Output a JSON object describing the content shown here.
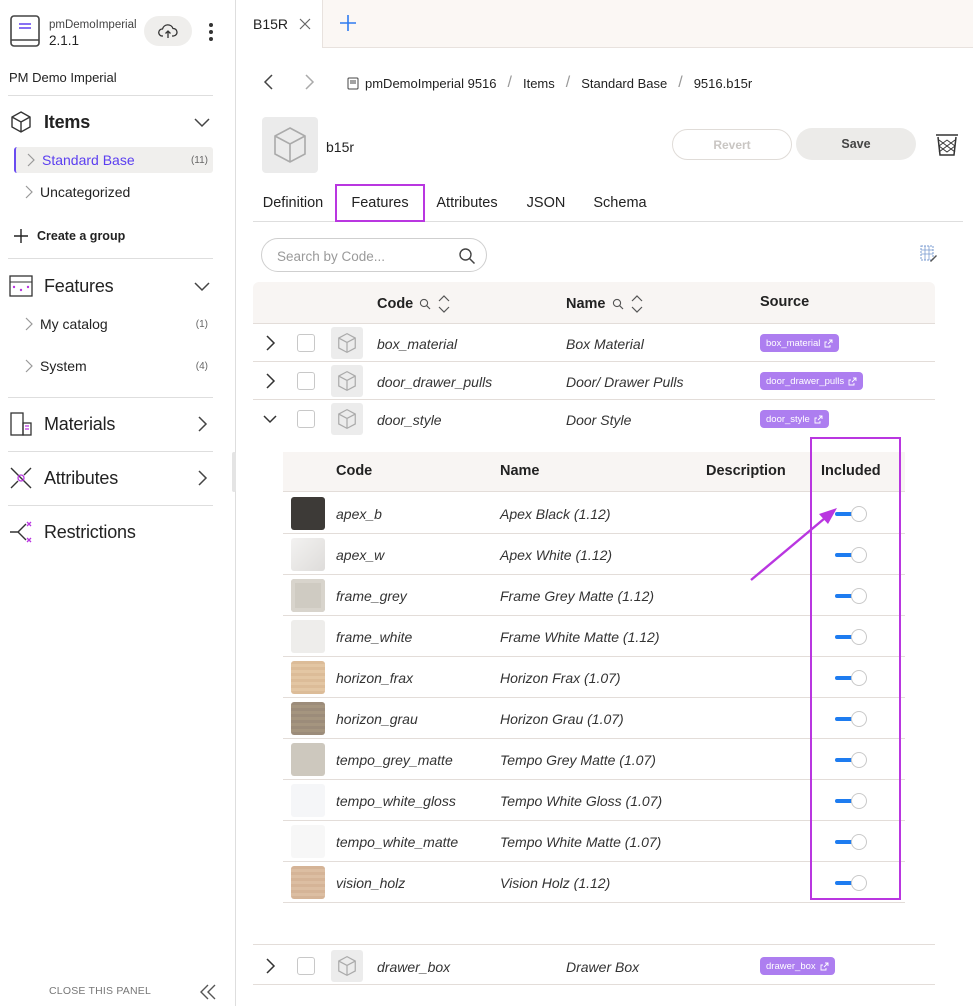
{
  "app": {
    "name": "pmDemoImperial",
    "version": "2.1.1",
    "project": "PM Demo Imperial"
  },
  "sidebar": {
    "items_section": {
      "label": "Items"
    },
    "item_groups": [
      {
        "label": "Standard Base",
        "count": "(11)"
      },
      {
        "label": "Uncategorized",
        "count": ""
      }
    ],
    "create_group": "Create a group",
    "features_section": {
      "label": "Features"
    },
    "feature_groups": [
      {
        "label": "My catalog",
        "count": "(1)"
      },
      {
        "label": "System",
        "count": "(4)"
      }
    ],
    "materials": "Materials",
    "attributes": "Attributes",
    "restrictions": "Restrictions",
    "close_panel": "CLOSE THIS PANEL"
  },
  "tabbar": {
    "tabs": [
      {
        "label": "B15R"
      }
    ]
  },
  "breadcrumb": [
    "pmDemoImperial 9516",
    "Items",
    "Standard Base",
    "9516.b15r"
  ],
  "item": {
    "code": "b15r"
  },
  "toolbar": {
    "revert_label": "Revert",
    "save_label": "Save"
  },
  "subtabs": [
    {
      "label": "Definition",
      "active": false
    },
    {
      "label": "Features",
      "active": true
    },
    {
      "label": "Attributes",
      "active": false
    },
    {
      "label": "JSON",
      "active": false
    },
    {
      "label": "Schema",
      "active": false
    }
  ],
  "search": {
    "placeholder": "Search by Code..."
  },
  "features_table": {
    "headers": {
      "code": "Code",
      "name": "Name",
      "source": "Source"
    },
    "rows": [
      {
        "code": "box_material",
        "name": "Box Material",
        "source": "box_material",
        "expanded": false
      },
      {
        "code": "door_drawer_pulls",
        "name": "Door/ Drawer Pulls",
        "source": "door_drawer_pulls",
        "expanded": false
      },
      {
        "code": "door_style",
        "name": "Door Style",
        "source": "door_style",
        "expanded": true
      },
      {
        "code": "drawer_box",
        "name": "Drawer Box",
        "source": "drawer_box",
        "expanded": false
      }
    ]
  },
  "options_table": {
    "headers": {
      "code": "Code",
      "name": "Name",
      "description": "Description",
      "included": "Included"
    },
    "rows": [
      {
        "code": "apex_b",
        "name": "Apex Black (1.12)",
        "swatch": "#3d3a37",
        "included": true
      },
      {
        "code": "apex_w",
        "name": "Apex White (1.12)",
        "swatch": "#e9e7e5",
        "included": true
      },
      {
        "code": "frame_grey",
        "name": "Frame Grey Matte (1.12)",
        "swatch": "#cfcbc2",
        "included": true
      },
      {
        "code": "frame_white",
        "name": "Frame White Matte (1.12)",
        "swatch": "#eeedeb",
        "included": true
      },
      {
        "code": "horizon_frax",
        "name": "Horizon Frax (1.07)",
        "swatch": "#dcbc98",
        "included": true
      },
      {
        "code": "horizon_grau",
        "name": "Horizon Grau (1.07)",
        "swatch": "#9c8c7a",
        "included": true
      },
      {
        "code": "tempo_grey_matte",
        "name": "Tempo Grey Matte (1.07)",
        "swatch": "#cdc8be",
        "included": true
      },
      {
        "code": "tempo_white_gloss",
        "name": "Tempo White Gloss (1.07)",
        "swatch": "#f5f6f8",
        "included": true
      },
      {
        "code": "tempo_white_matte",
        "name": "Tempo White Matte (1.07)",
        "swatch": "#f7f7f7",
        "included": true
      },
      {
        "code": "vision_holz",
        "name": "Vision Holz (1.12)",
        "swatch": "#d5b497",
        "included": true
      }
    ]
  },
  "colors": {
    "accent": "#5b3ff0",
    "highlight": "#b936e0",
    "toggle_on": "#1e7cf0",
    "source_badge": "#ad7ef0"
  }
}
